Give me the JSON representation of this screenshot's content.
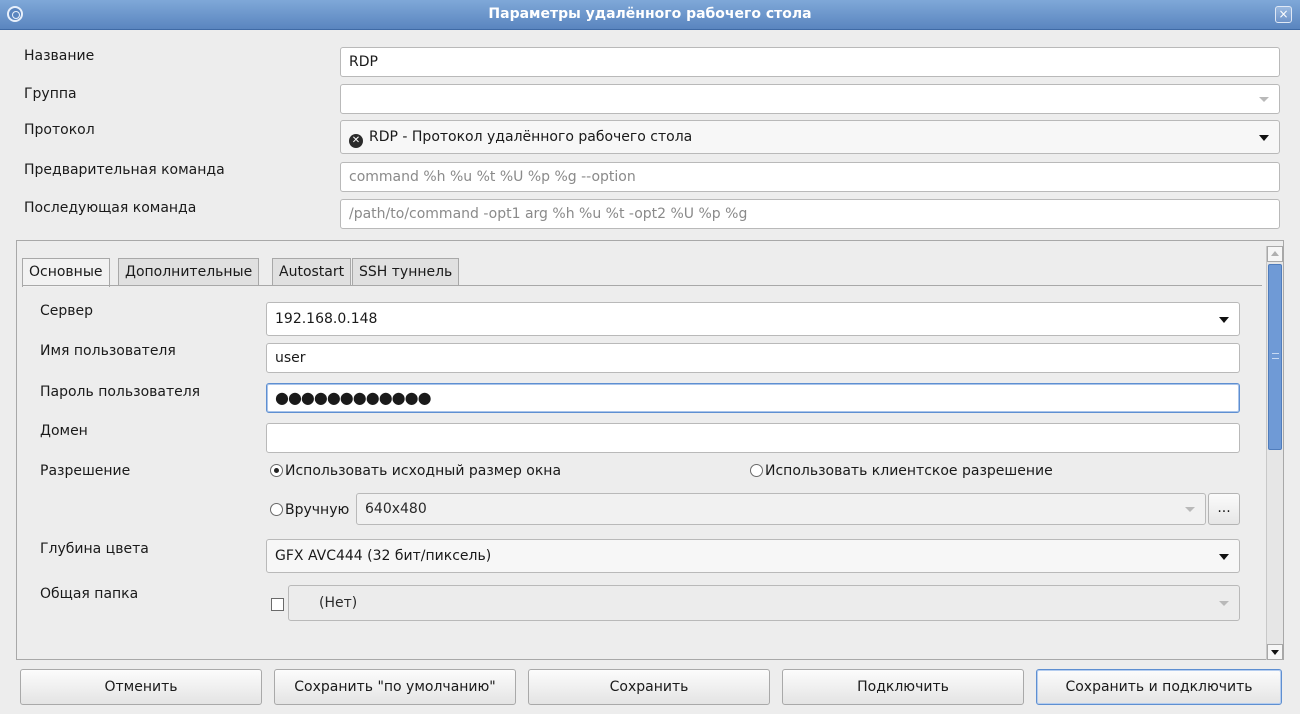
{
  "window": {
    "title": "Параметры удалённого рабочего стола",
    "close_glyph": "×"
  },
  "form": {
    "name": {
      "label": "Название",
      "value": "RDP"
    },
    "group": {
      "label": "Группа",
      "value": ""
    },
    "protocol": {
      "label": "Протокол",
      "value": "RDP - Протокол удалённого рабочего стола",
      "icon": "plugin-icon"
    },
    "precommand": {
      "label": "Предварительная команда",
      "placeholder": "command %h %u %t %U %p %g --option"
    },
    "postcommand": {
      "label": "Последующая команда",
      "placeholder": "/path/to/command -opt1 arg %h %u %t -opt2 %U %p %g"
    }
  },
  "tabs": [
    {
      "label": "Основные",
      "active": true
    },
    {
      "label": "Дополнительные"
    },
    {
      "label": "Autostart"
    },
    {
      "label": "SSH туннель"
    }
  ],
  "basic": {
    "server": {
      "label": "Сервер",
      "value": "192.168.0.148"
    },
    "username": {
      "label": "Имя пользователя",
      "value": "user"
    },
    "password": {
      "label": "Пароль пользователя",
      "value": "●●●●●●●●●●●●"
    },
    "domain": {
      "label": "Домен",
      "value": ""
    },
    "resolution": {
      "label": "Разрешение",
      "option_native": "Использовать исходный размер окна",
      "option_client": "Использовать клиентское разрешение",
      "option_manual": "Вручную",
      "manual_value": "640x480",
      "more_button": "...",
      "selected": "native"
    },
    "color_depth": {
      "label": "Глубина цвета",
      "value": "GFX AVC444 (32 бит/пиксель)"
    },
    "shared_folder": {
      "label": "Общая папка",
      "value": "(Нет)",
      "checked": false
    }
  },
  "buttons": {
    "cancel": "Отменить",
    "save_default": "Сохранить \"по умолчанию\"",
    "save": "Сохранить",
    "connect": "Подключить",
    "save_connect": "Сохранить и подключить"
  },
  "colors": {
    "titlebar": "#5a85bf",
    "focus": "#5e8fd1",
    "scroll_thumb": "#6f9ad6"
  }
}
